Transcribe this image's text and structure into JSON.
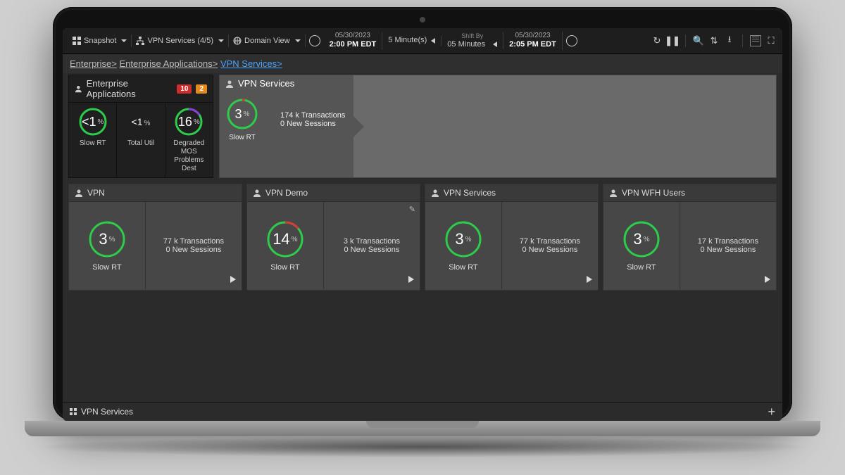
{
  "toolbar": {
    "snapshot_label": "Snapshot",
    "services_label": "VPN Services (4/5)",
    "view_label": "Domain View",
    "start_date": "05/30/2023",
    "start_time": "2:00 PM EDT",
    "step_value": "5 Minute(s)",
    "shift_label": "Shift By",
    "shift_value": "05 Minutes",
    "end_date": "05/30/2023",
    "end_time": "2:05 PM EDT"
  },
  "breadcrumb": {
    "b1": "Enterprise>",
    "b2": "Enterprise Applications>",
    "b3": "VPN Services>"
  },
  "enterprise_card": {
    "title": "Enterprise Applications",
    "badge_red": "10",
    "badge_orange": "2",
    "m1_val": "<1",
    "m1_unit": "%",
    "m1_label": "Slow RT",
    "m2_val": "<1",
    "m2_unit": "%",
    "m2_label": "Total Util",
    "m3_val": "16",
    "m3_unit": "%",
    "m3_label": "Degraded MOS Problems Dest"
  },
  "vpn_hero": {
    "title": "VPN Services",
    "val": "3",
    "unit": "%",
    "label": "Slow RT",
    "stat1": "174 k  Transactions",
    "stat2": "0  New Sessions"
  },
  "cards": [
    {
      "title": "VPN",
      "val": "3",
      "unit": "%",
      "label": "Slow RT",
      "s1": "77 k Transactions",
      "s2": "0 New Sessions",
      "arc": 12,
      "color": "#2dcc4b"
    },
    {
      "title": "VPN Demo",
      "val": "14",
      "unit": "%",
      "label": "Slow RT",
      "s1": "3 k Transactions",
      "s2": "0 New Sessions",
      "arc": 50,
      "color": "#d63a3a",
      "edit": true
    },
    {
      "title": "VPN Services",
      "val": "3",
      "unit": "%",
      "label": "Slow RT",
      "s1": "77 k Transactions",
      "s2": "0 New Sessions",
      "arc": 12,
      "color": "#2dcc4b"
    },
    {
      "title": "VPN WFH Users",
      "val": "3",
      "unit": "%",
      "label": "Slow RT",
      "s1": "17 k Transactions",
      "s2": "0 New Sessions",
      "arc": 12,
      "color": "#2dcc4b"
    }
  ],
  "footer": {
    "tab": "VPN Services"
  }
}
